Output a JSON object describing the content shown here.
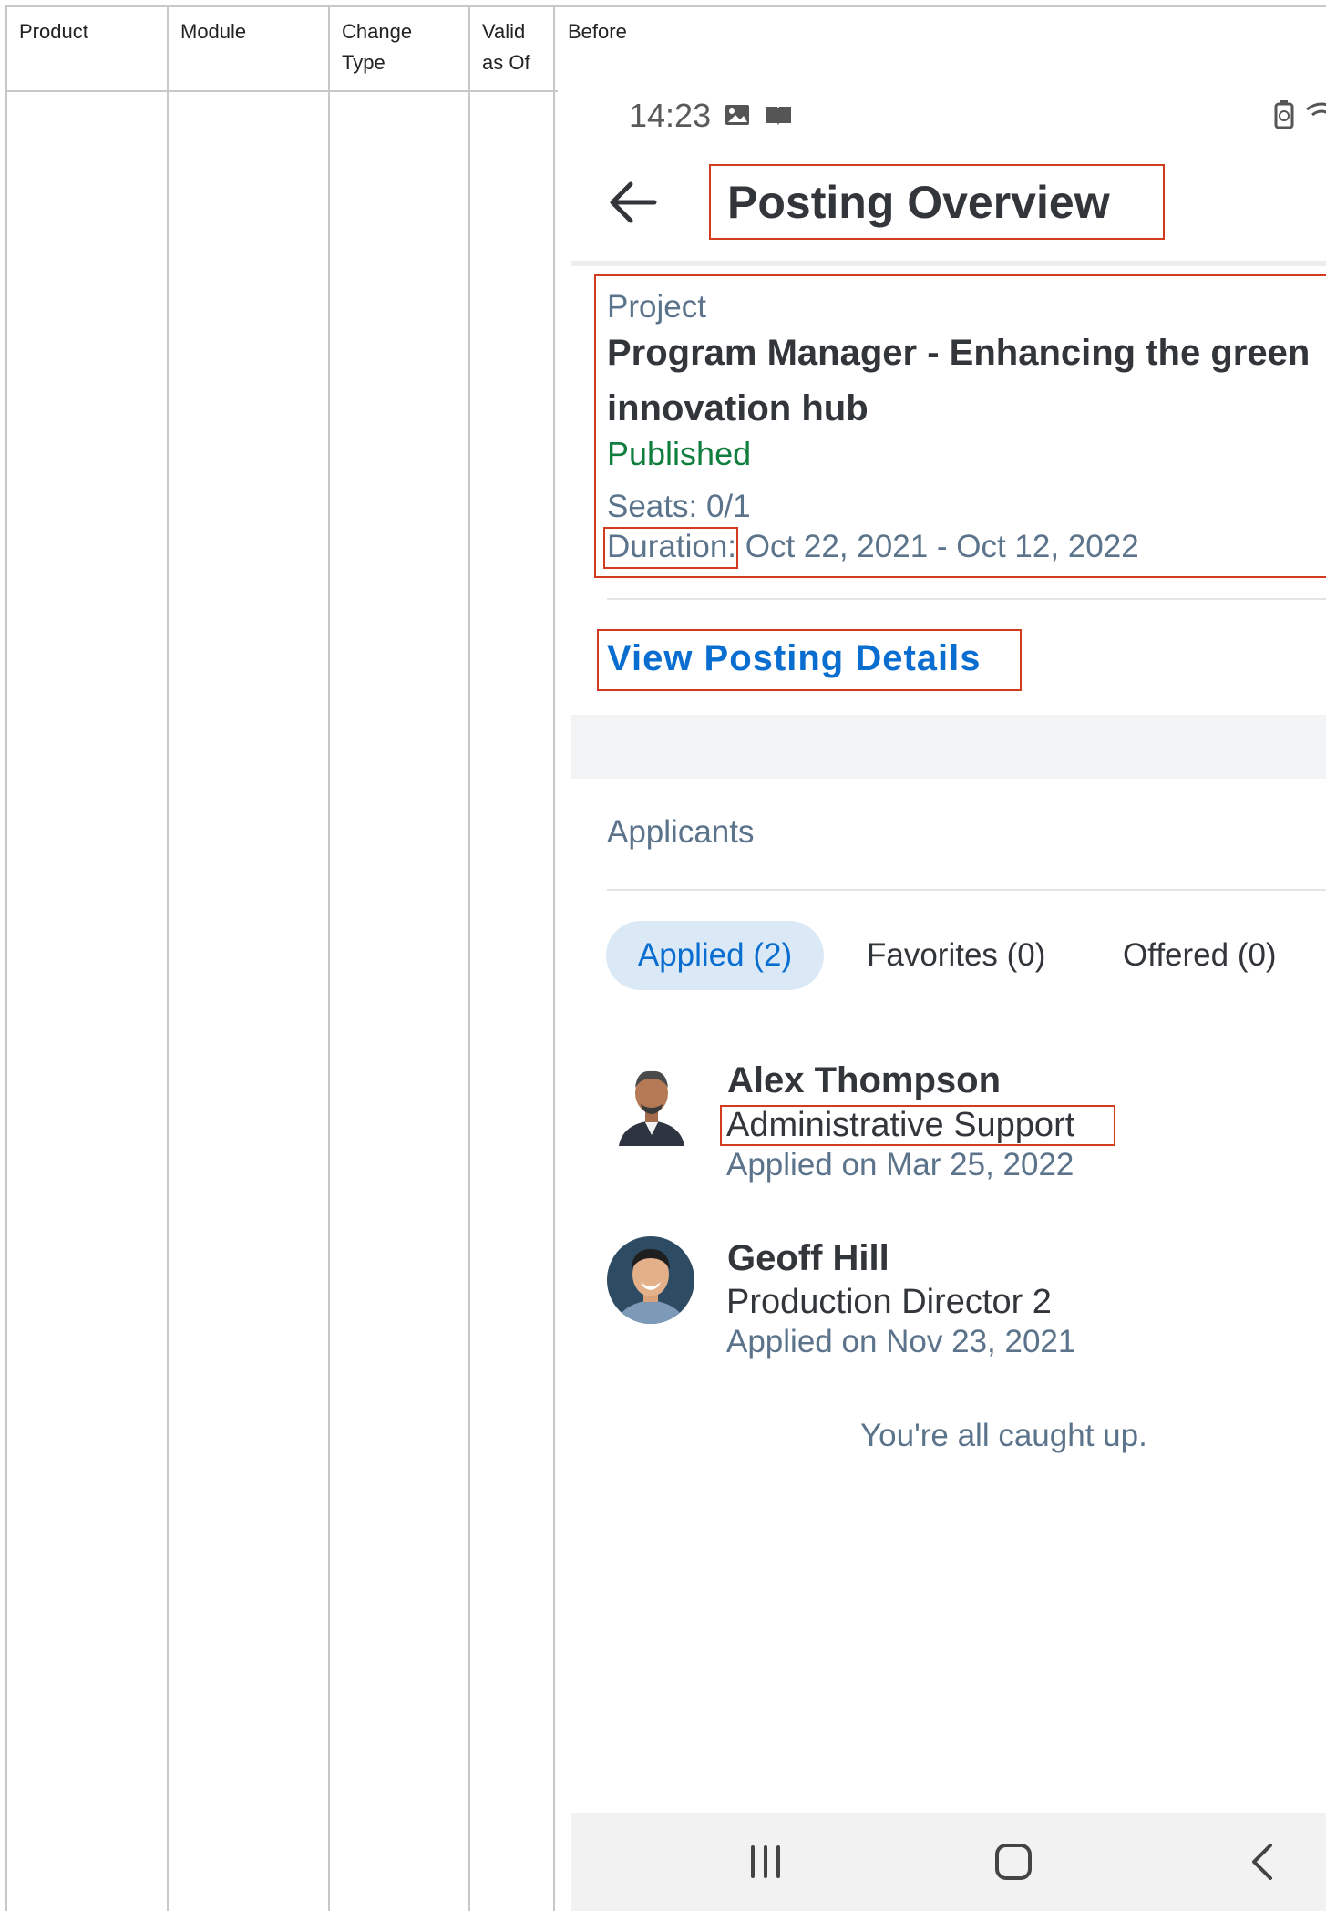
{
  "table": {
    "headers": {
      "product": "Product",
      "module": "Module",
      "change_type": "Change\nType",
      "valid_as_of": "Valid\nas Of",
      "before": "Before"
    }
  },
  "phone": {
    "status_bar": {
      "time": "14:23",
      "icons": [
        "image-icon",
        "book-icon",
        "battery-saver-icon",
        "wifi-icon"
      ]
    },
    "header": {
      "title": "Posting Overview",
      "back_icon": "arrow-left-icon"
    },
    "project": {
      "label": "Project",
      "title_line1": "Program Manager - Enhancing the green",
      "title_line2": "innovation hub",
      "status": "Published",
      "seats": "Seats: 0/1",
      "duration_label": "Duration",
      "duration_value": ": Oct 22, 2021 - Oct 12, 2022"
    },
    "view_details_link": "View Posting Details",
    "applicants": {
      "section_title": "Applicants",
      "tabs": [
        {
          "label": "Applied (2)",
          "selected": true
        },
        {
          "label": "Favorites (0)",
          "selected": false
        },
        {
          "label": "Offered (0)",
          "selected": false
        }
      ],
      "list": [
        {
          "name": "Alex Thompson",
          "role": "Administrative Support",
          "applied": "Applied on Mar 25, 2022"
        },
        {
          "name": "Geoff Hill",
          "role": "Production Director 2",
          "applied": "Applied on Nov 23, 2021"
        }
      ],
      "end_message": "You're all caught up."
    },
    "nav_bar": {
      "icons": [
        "recent-apps-icon",
        "home-icon",
        "back-icon"
      ]
    },
    "colors": {
      "accent": "#0a6ed1",
      "published": "#107e3e",
      "highlight_border": "#d23b1e",
      "tab_selected_bg": "#dbe9f6",
      "text_dark": "#32363a",
      "text_muted": "#5b738b"
    }
  }
}
